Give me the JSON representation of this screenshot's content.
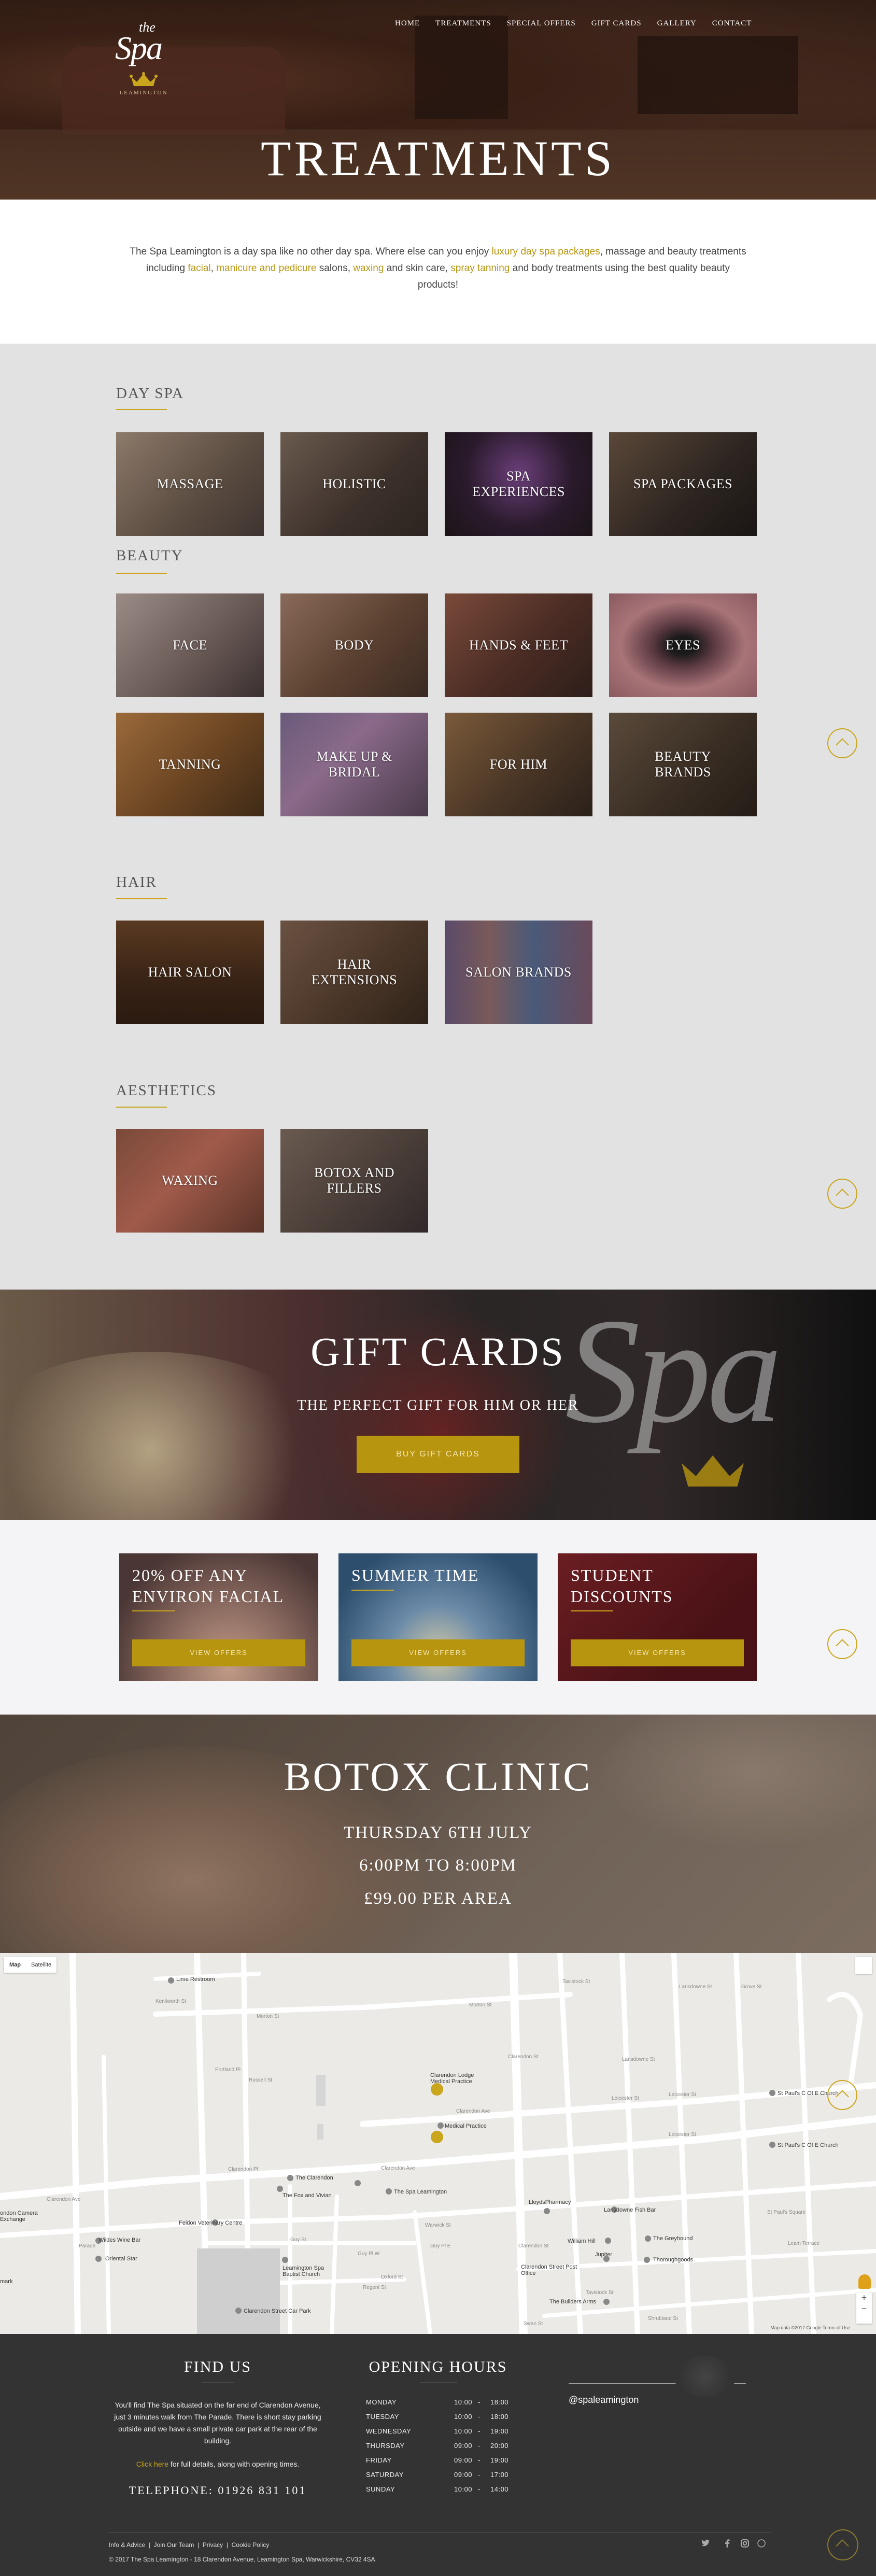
{
  "brand": {
    "the": "the",
    "spa": "Spa",
    "location": "LEAMINGTON"
  },
  "nav": [
    "HOME",
    "TREATMENTS",
    "SPECIAL OFFERS",
    "GIFT CARDS",
    "GALLERY",
    "CONTACT"
  ],
  "hero": {
    "title": "TREATMENTS"
  },
  "intro": {
    "p1": "The Spa Leamington is a day spa like no other day spa. Where else can you enjoy ",
    "link_packages": "luxury day spa packages",
    "p2": ", massage and beauty treatments",
    "p3": "including ",
    "link_facial": "facial",
    "comma": ", ",
    "link_manicure": "manicure and pedicure",
    "p4": " salons, ",
    "link_waxing": "waxing",
    "p5": " and skin care, ",
    "link_tanning": "spray tanning",
    "p6": " and body treatments using the best quality beauty",
    "p7": "products!"
  },
  "sections": {
    "day_spa": {
      "title": "DAY SPA",
      "tiles": [
        "MASSAGE",
        "HOLISTIC",
        "SPA EXPERIENCES",
        "SPA PACKAGES"
      ]
    },
    "beauty": {
      "title": "BEAUTY",
      "tiles": [
        "FACE",
        "BODY",
        "HANDS & FEET",
        "EYES",
        "TANNING",
        "MAKE UP & BRIDAL",
        "FOR HIM",
        "BEAUTY BRANDS"
      ]
    },
    "hair": {
      "title": "HAIR",
      "tiles": [
        "HAIR SALON",
        "HAIR EXTENSIONS",
        "SALON BRANDS"
      ]
    },
    "aesthetics": {
      "title": "AESTHETICS",
      "tiles": [
        "WAXING",
        "BOTOX AND FILLERS"
      ]
    }
  },
  "gift": {
    "title": "GIFT CARDS",
    "subtitle": "THE PERFECT GIFT FOR HIM OR HER",
    "button": "BUY GIFT CARDS",
    "watermark": "Spa"
  },
  "offers": [
    {
      "title_1": "20% OFF ANY",
      "title_2": "ENVIRON FACIAL",
      "button": "VIEW OFFERS"
    },
    {
      "title_1": "SUMMER TIME",
      "title_2": "",
      "button": "VIEW OFFERS"
    },
    {
      "title_1": "STUDENT",
      "title_2": "DISCOUNTS",
      "button": "VIEW OFFERS"
    }
  ],
  "botox": {
    "title": "BOTOX CLINIC",
    "line1": "THURSDAY 6TH JULY",
    "line2": "6:00PM TO 8:00PM",
    "line3": "£99.00 PER AREA"
  },
  "map": {
    "type_map": "Map",
    "type_sat": "Satellite",
    "attribution": "Map data ©2017 Google   Terms of Use",
    "places": [
      "Lime Restroom",
      "Clarendon Lodge Medical Practice",
      "Medical Practice",
      "The Clarendon",
      "The Fox and Vivian",
      "The Spa Leamington",
      "Feldon Veterinary Centre",
      "LloydsPharmacy",
      "Lansdowne Fish Bar",
      "St Paul's C Of E Church",
      "St Paul's C Of E Church",
      "William Hill",
      "The Greyhound",
      "Jupiter",
      "Thoroughgoods",
      "Clarendon Street Post Office",
      "The Builders Arms",
      "Leamington Spa Baptist Church",
      "Clarendon Street Car Park",
      "Wildes Wine Bar",
      "Oriental Star",
      "ondon Camera Exchange",
      "mark"
    ],
    "streets": [
      "Kenilworth St",
      "Morton St",
      "Morton St",
      "Clarendon Ave",
      "Clarendon Ave",
      "Leicester St",
      "Leicester St",
      "Leicester St",
      "Clarendon Pl",
      "Clarendon Ave",
      "Clarendon St",
      "Warwick St",
      "Guy St",
      "Guy Pl W",
      "Regent St",
      "Parade",
      "Russell St",
      "Oxford St",
      "Portland Pl",
      "Clarendon St",
      "Tavistock St",
      "Lansdowne St",
      "Lansdowne St",
      "St Paul's Square",
      "Leam Terrace",
      "Grove St",
      "Tavistock St",
      "Guy Pl E",
      "Swan St",
      "Shrubland St"
    ]
  },
  "footer": {
    "find_us": "FIND US",
    "address_1": "You'll find The Spa situated on the far end of Clarendon Avenue,",
    "address_2": "just 3 minutes walk from The Parade. There is short stay parking",
    "address_3": "outside and we have a small private car park at the rear of the",
    "address_4": "building.",
    "click_here": "Click here",
    "details": " for full details, along with opening times.",
    "telephone": "TELEPHONE: 01926 831 101",
    "opening_hours": "OPENING HOURS",
    "hours": [
      {
        "day": "MONDAY",
        "open": "10:00",
        "sep": "-",
        "close": "18:00"
      },
      {
        "day": "TUESDAY",
        "open": "10:00",
        "sep": "-",
        "close": "18:00"
      },
      {
        "day": "WEDNESDAY",
        "open": "10:00",
        "sep": "-",
        "close": "19:00"
      },
      {
        "day": "THURSDAY",
        "open": "09:00",
        "sep": "-",
        "close": "20:00"
      },
      {
        "day": "FRIDAY",
        "open": "09:00",
        "sep": "-",
        "close": "19:00"
      },
      {
        "day": "SATURDAY",
        "open": "09:00",
        "sep": "-",
        "close": "17:00"
      },
      {
        "day": "SUNDAY",
        "open": "10:00",
        "sep": "-",
        "close": "14:00"
      }
    ],
    "instagram": "@spaleamington",
    "links": [
      "Info & Advice",
      "Join Our Team",
      "Privacy",
      "Cookie Policy"
    ],
    "link_sep": "|",
    "copyright": "© 2017 The Spa Leamington - 18 Clarendon Avenue, Leamington Spa, Warwickshire, CV32 4SA"
  },
  "colors": {
    "gold": "#b8950f",
    "grey_bg": "#e2e2e2",
    "footer_bg": "#333333",
    "offer_red": "#5a1a1e",
    "offer_blue": "#3d5d7a"
  },
  "icons": {
    "twitter": "twitter-icon",
    "facebook": "facebook-icon",
    "instagram": "instagram-icon",
    "pinterest": "pinterest-icon",
    "back_to_top": "chevron-up-icon"
  }
}
